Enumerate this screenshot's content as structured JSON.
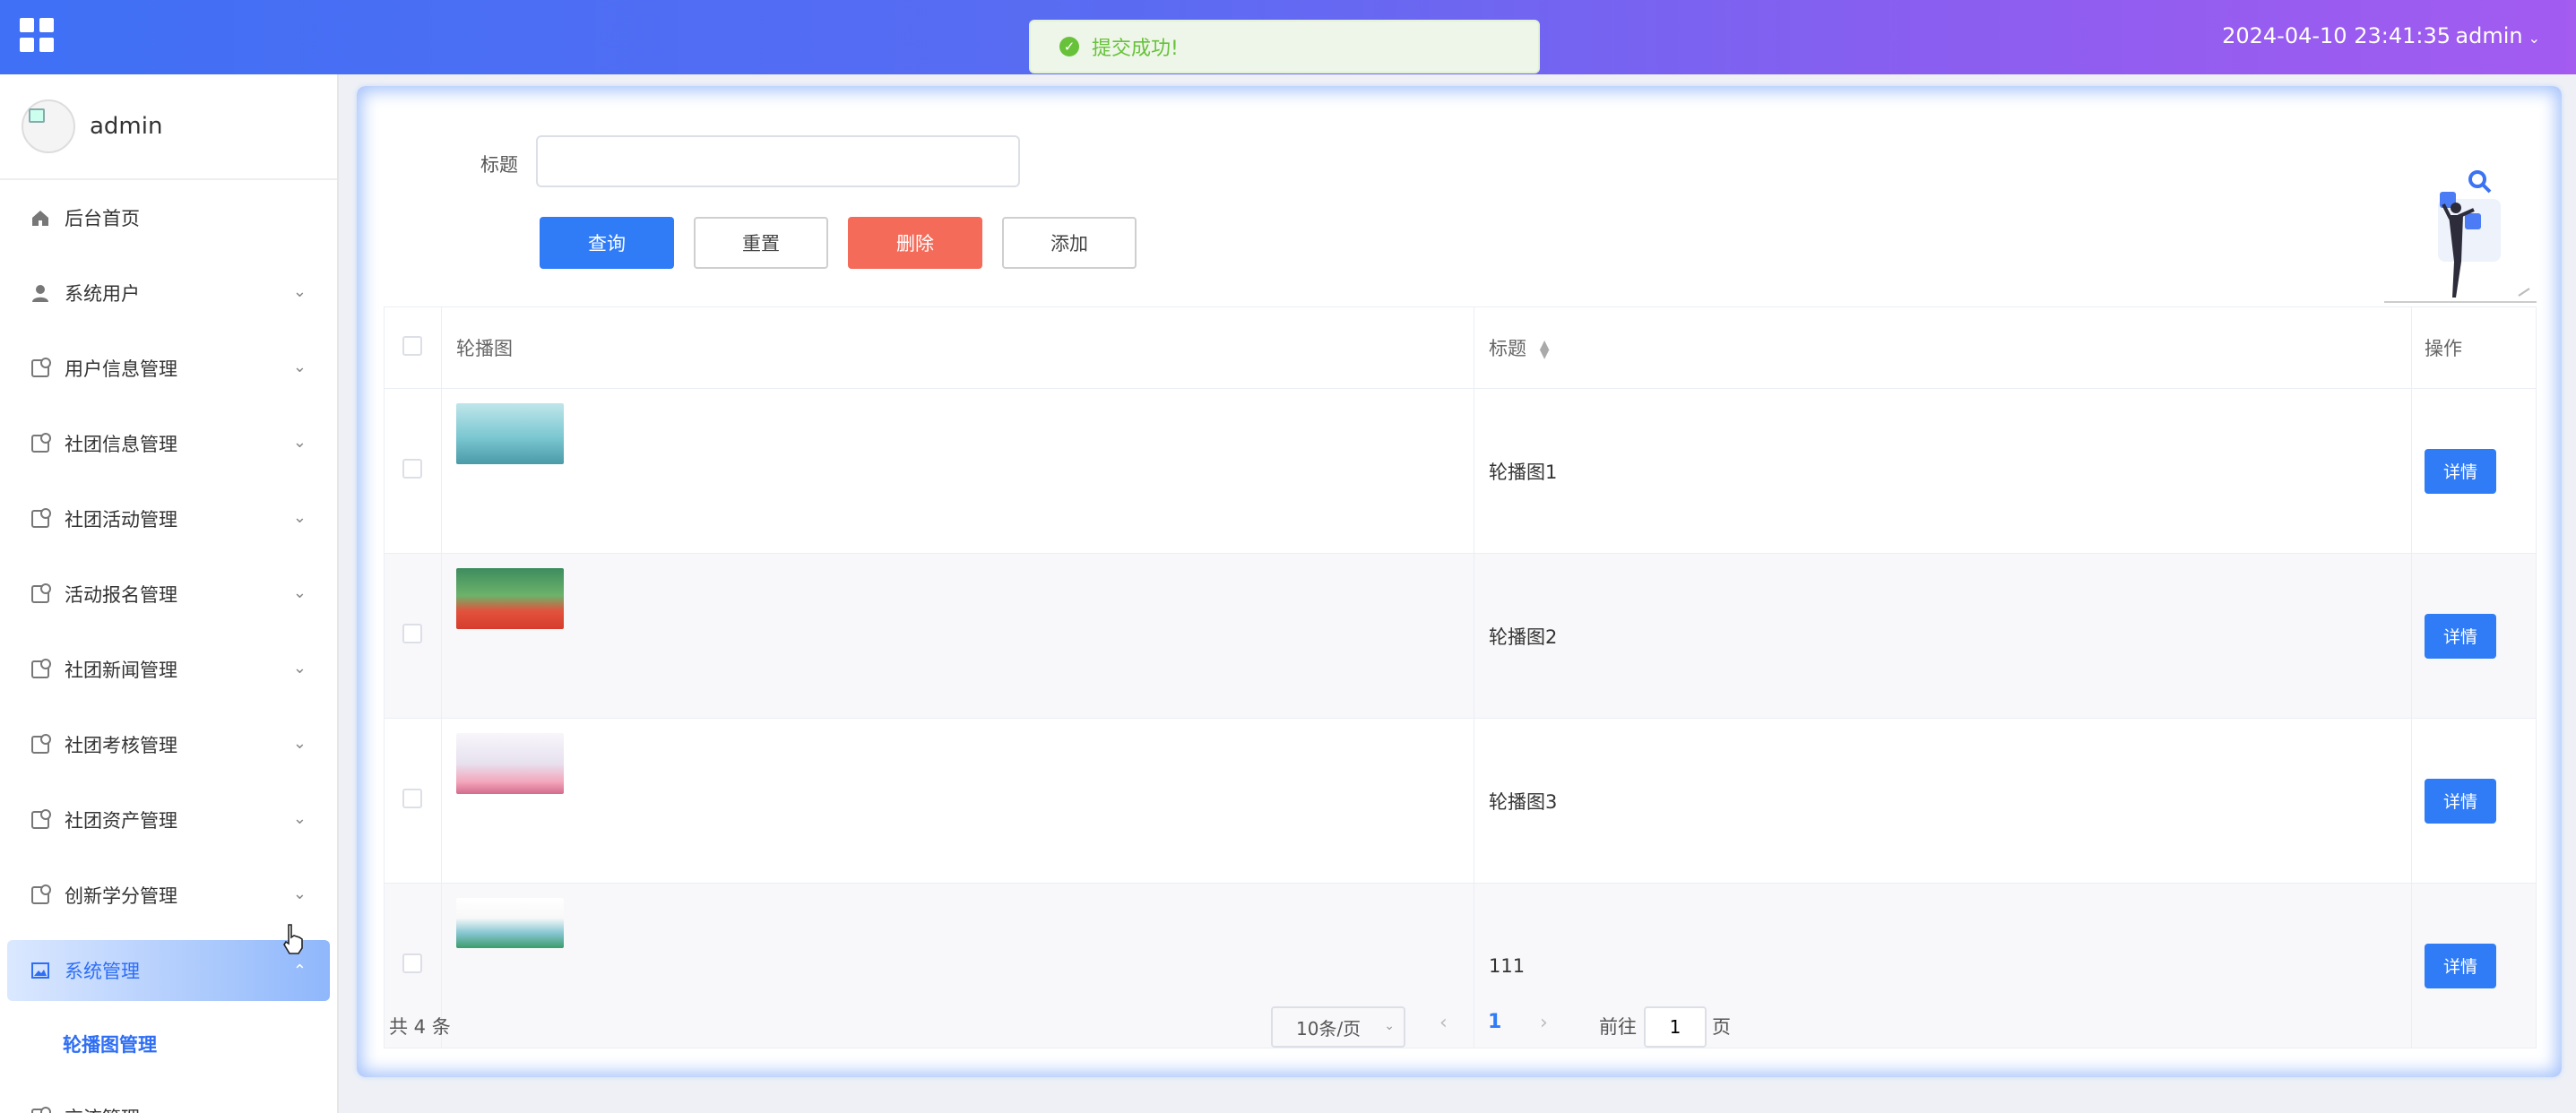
{
  "header": {
    "datetime": "2024-04-10 23:41:35",
    "user": "admin"
  },
  "toast": {
    "message": "提交成功!"
  },
  "sidebar": {
    "username": "admin",
    "items": [
      {
        "label": "后台首页",
        "icon": "home-icon"
      },
      {
        "label": "系统用户",
        "icon": "user-icon"
      },
      {
        "label": "用户信息管理",
        "icon": "folder-icon"
      },
      {
        "label": "社团信息管理",
        "icon": "folder-icon"
      },
      {
        "label": "社团活动管理",
        "icon": "folder-icon"
      },
      {
        "label": "活动报名管理",
        "icon": "folder-icon"
      },
      {
        "label": "社团新闻管理",
        "icon": "folder-icon"
      },
      {
        "label": "社团考核管理",
        "icon": "folder-icon"
      },
      {
        "label": "社团资产管理",
        "icon": "folder-icon"
      },
      {
        "label": "创新学分管理",
        "icon": "folder-icon"
      },
      {
        "label": "系统管理",
        "icon": "picture-icon"
      },
      {
        "label": "交流管理",
        "icon": "folder-icon"
      }
    ],
    "submenu": {
      "label": "轮播图管理"
    }
  },
  "search": {
    "label": "标题",
    "value": "",
    "placeholder": ""
  },
  "toolbar": {
    "query": "查询",
    "reset": "重置",
    "delete": "删除",
    "add": "添加"
  },
  "table": {
    "headers": {
      "image": "轮播图",
      "title": "标题",
      "op": "操作"
    },
    "rows": [
      {
        "title": "轮播图1",
        "action": "详情"
      },
      {
        "title": "轮播图2",
        "action": "详情"
      },
      {
        "title": "轮播图3",
        "action": "详情"
      },
      {
        "title": "111",
        "action": "详情"
      }
    ]
  },
  "pagination": {
    "total": "共 4 条",
    "page_size": "10条/页",
    "current": "1",
    "goto_label": "前往",
    "goto_value": "1",
    "goto_suffix": "页"
  },
  "colors": {
    "primary": "#2f7cf6",
    "danger": "#f56b5a",
    "success": "#67c23a"
  }
}
